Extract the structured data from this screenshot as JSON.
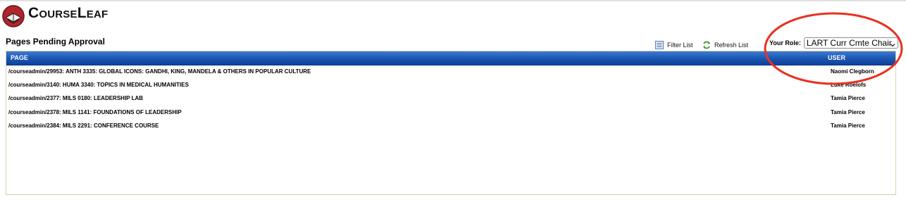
{
  "app": {
    "logo_text": "CourseLeaf"
  },
  "page": {
    "title": "Pages Pending Approval"
  },
  "toolbar": {
    "filter_label": "Filter List",
    "refresh_label": "Refresh List"
  },
  "role": {
    "label": "Your Role:",
    "selected": "LART Curr Cmte Chair"
  },
  "table": {
    "columns": {
      "page": "PAGE",
      "user": "USER"
    },
    "rows": [
      {
        "page": "/courseadmin/29953: ANTH 3335: GLOBAL ICONS: GANDHI, KING, MANDELA & OTHERS IN POPULAR CULTURE",
        "user": "Naomi Clegborn"
      },
      {
        "page": "/courseadmin/3140: HUMA 3340: TOPICS IN MEDICAL HUMANITIES",
        "user": "Luke Roelofs"
      },
      {
        "page": "/courseadmin/2377: MILS 0180: LEADERSHIP LAB",
        "user": "Tamia Pierce"
      },
      {
        "page": "/courseadmin/2378: MILS 1141: FOUNDATIONS OF LEADERSHIP",
        "user": "Tamia Pierce"
      },
      {
        "page": "/courseadmin/2384: MILS 2291: CONFERENCE COURSE",
        "user": "Tamia Pierce"
      }
    ]
  },
  "colors": {
    "header_blue": "#1c58b4",
    "annotation_red": "#e8321f",
    "logo_red": "#b0262c"
  },
  "icons": [
    "courseleaf-logo-icon",
    "filter-list-icon",
    "refresh-list-icon",
    "chevron-down-icon"
  ]
}
